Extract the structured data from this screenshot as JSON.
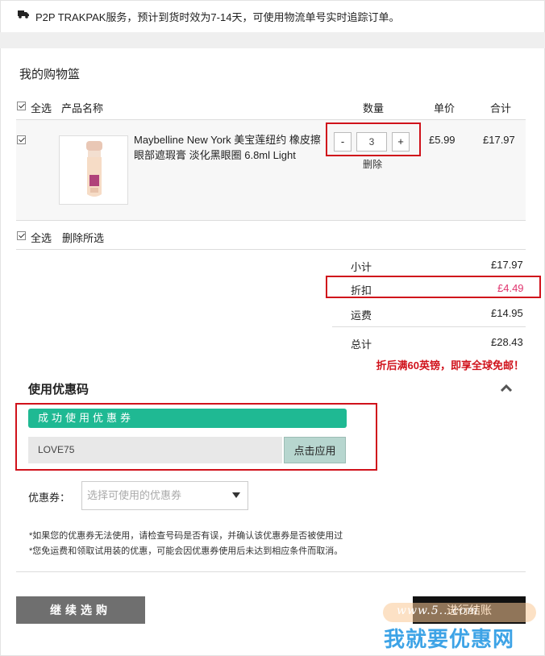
{
  "shipping_banner": {
    "icon": "truck-icon",
    "text": "P2P TRAKPAK服务，预计到货时效为7-14天，可使用物流单号实时追踪订单。"
  },
  "cart": {
    "title": "我的购物篮",
    "select_all": "全选",
    "headers": {
      "product": "产品名称",
      "qty": "数量",
      "unit_price": "单价",
      "total": "合计"
    },
    "item": {
      "name": "Maybelline New York 美宝莲纽约 橡皮擦眼部遮瑕膏 淡化黑眼圈 6.8ml Light",
      "qty": "3",
      "minus": "-",
      "plus": "+",
      "delete": "删除",
      "unit_price": "£5.99",
      "total": "£17.97",
      "checked": true
    },
    "footer": {
      "select_all": "全选",
      "delete_selected": "删除所选"
    }
  },
  "summary": {
    "subtotal_label": "小计",
    "subtotal": "£17.97",
    "discount_label": "折扣",
    "discount": "£4.49",
    "shipping_label": "运费",
    "shipping": "£14.95",
    "total_label": "总计",
    "total": "£28.43",
    "promo": "折后满60英镑，即享全球免邮！"
  },
  "coupon": {
    "title": "使用优惠码",
    "success": "成功使用优惠券",
    "code": "LOVE75",
    "apply": "点击应用",
    "select_label": "优惠券：",
    "select_placeholder": "选择可使用的优惠券",
    "notes": [
      "*如果您的优惠券无法使用，请检查号码是否有误，并确认该优惠券是否被使用过",
      "*您免运费和领取试用装的优惠，可能会因优惠券使用后未达到相应条件而取消。"
    ]
  },
  "actions": {
    "continue": "继续选购",
    "checkout": "进行结账"
  },
  "watermark": {
    "url": "www.5...com",
    "text": "我就要优惠网"
  },
  "colors": {
    "green": "#1fb993",
    "red": "#d0121b",
    "pink": "#e0356e"
  }
}
